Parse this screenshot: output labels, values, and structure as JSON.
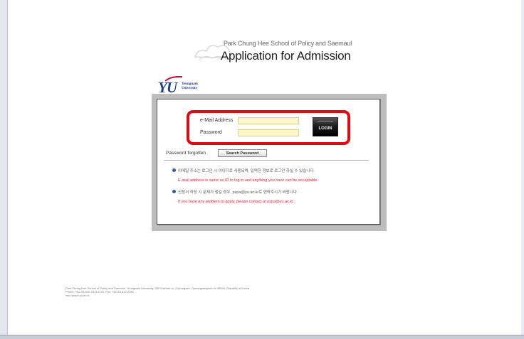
{
  "header": {
    "school": "Park Chung Hee School of Policy and Saemaul",
    "title": "Application for Admission"
  },
  "logo": {
    "letters": "YU",
    "name_line1": "Yeungnam",
    "name_line2": "University"
  },
  "login": {
    "email_label": "e-Mail Address",
    "password_label": "Password",
    "email_value": "",
    "password_value": "",
    "button_label": "LOGIN",
    "highlight_color": "#e30613"
  },
  "password_help": {
    "label": "Password forgotten",
    "button_label": "Search Password"
  },
  "notes": [
    {
      "korean": "이메일 주소는 로그인 시 아이디로 사용되며, 입력한 정보로 로그인 하실 수 있습니다.",
      "english": "E-mail address is same as ID to log in and anything you have can be acceptable."
    },
    {
      "korean": "신청서 작성 시 문제가 생길 경우, pspa@yu.ac.kr로 연락주시기 바랍니다.",
      "english": "If you have any problem to apply, please contact at pspa@yu.ac.kr"
    }
  ],
  "footer": {
    "line1": "Park Chung Hee School of Policy and Saemaul, Yeungnam University, 280 Daehak-ro, Gyeongsan, Gyeongsangbuk-do 38541, Republic of Korea",
    "line2": "Phone: +82-53-810-1411/1124, Fax: +82-53-810-2051",
    "line3": "http://pspa.yu.ac.kr"
  },
  "colors": {
    "accent_red": "#e30613",
    "bullet_blue": "#2f5bb7",
    "input_bg": "#fdf6c6",
    "english_note": "#d8292f"
  }
}
